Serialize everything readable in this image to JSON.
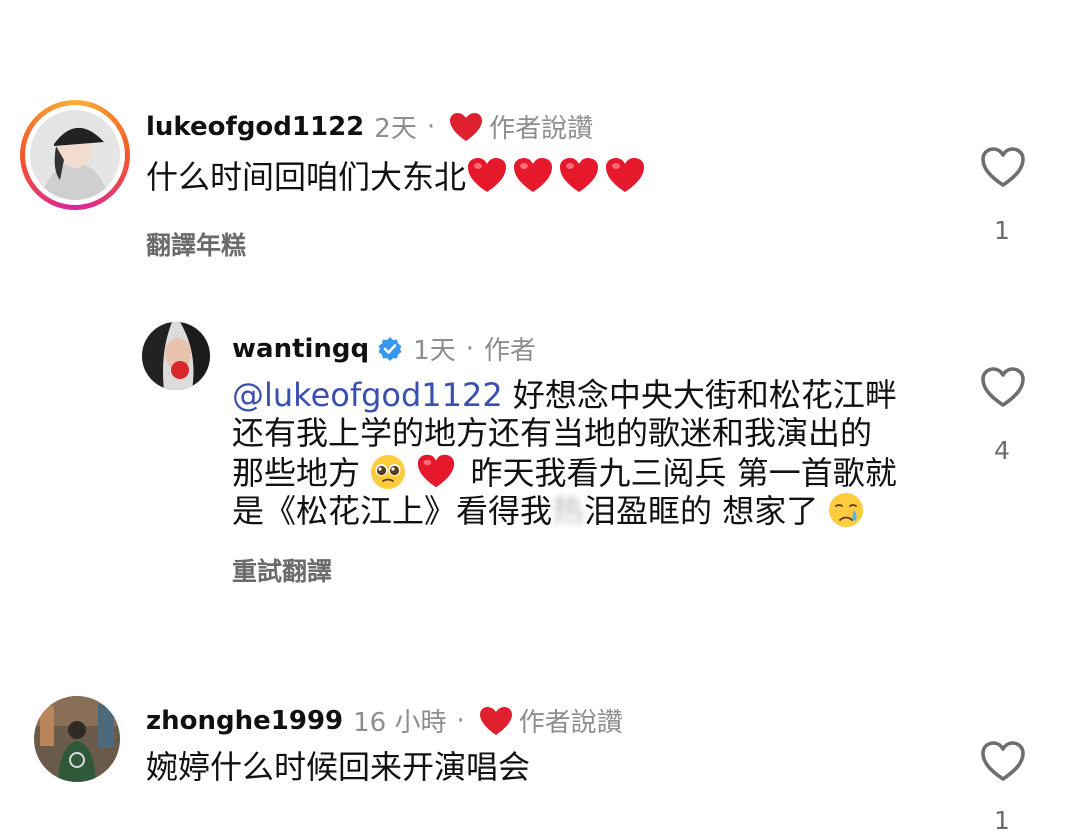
{
  "comments": [
    {
      "username": "lukeofgod1122",
      "time": "2天",
      "dot": "·",
      "author_badge": "作者說讚",
      "text": "什么时间回咱们大东北",
      "translate": "翻譯年糕",
      "likes": "1"
    },
    {
      "username": "wantingq",
      "time": "1天",
      "dot": "·",
      "author_badge": "作者",
      "mention": "@lukeofgod1122",
      "line1": "好想念中央大街和松花江畔",
      "line2": "还有我上学的地方还有当地的歌迷和我演出的",
      "line3a": "那些地方",
      "line3b": "昨天我看九三阅兵 第一首歌就",
      "line4a": "是《松花江上》看得我",
      "line4_blur": "热",
      "line4b": "泪盈眶的 想家了",
      "translate": "重試翻譯",
      "likes": "4"
    },
    {
      "username": "zhonghe1999",
      "time": "16 小時",
      "dot": "·",
      "author_badge": "作者說讚",
      "text": "婉婷什么时候回来开演唱会",
      "likes": "1"
    }
  ],
  "colors": {
    "heart": "#e0202f",
    "mention": "#3a4fb0",
    "verified": "#3897f0",
    "meta": "#8e8e8e"
  },
  "icons": [
    "heart-outline-icon",
    "heart-filled-icon",
    "verified-badge-icon",
    "pleading-face-emoji",
    "crying-face-emoji"
  ]
}
